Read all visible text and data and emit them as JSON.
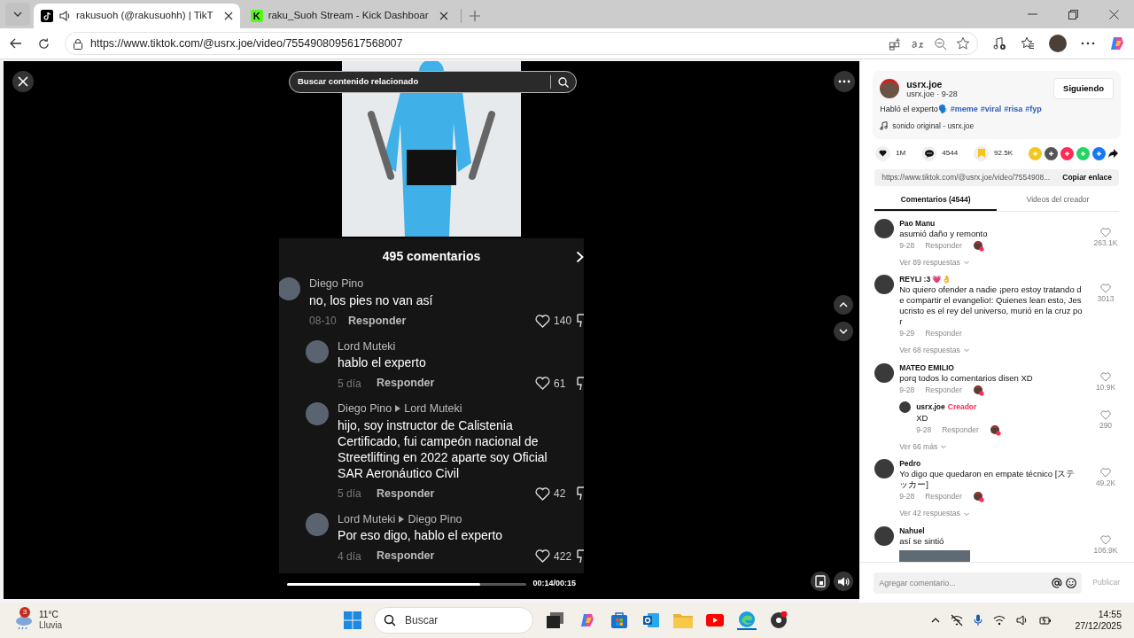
{
  "browser": {
    "tabs": [
      {
        "kind": "music-note",
        "title": "rakusuoh (@rakusuohh) | TikT",
        "playing": true,
        "selected": true
      },
      {
        "kind": "letter",
        "letter": "K",
        "title": "raku_Suoh Stream - Kick Dashboar",
        "playing": false,
        "selected": false
      }
    ],
    "url": "https://www.tiktok.com/@usrx.joe/video/7554908095617568007"
  },
  "video": {
    "search_placeholder": "Buscar contenido relacionado",
    "comments_title": "495 comentarios",
    "comments": [
      {
        "name": "Diego Pino",
        "text": "no, los pies no van así",
        "date": "08-10",
        "reply": "Responder",
        "likes": "140",
        "children": [
          {
            "name": "Lord Muteki",
            "text": "hablo el experto",
            "date": "5 día",
            "reply": "Responder",
            "likes": "61"
          },
          {
            "name": "Diego Pino",
            "reply_to": "Lord Muteki",
            "text": "hijo, soy instructor de Calistenia Certificado, fui campeón nacional de Streetlifting en 2022 aparte soy Oficial SAR Aeronáutico Civil",
            "date": "5 día",
            "reply": "Responder",
            "likes": "42"
          },
          {
            "name": "Lord Muteki",
            "reply_to": "Diego Pino",
            "text": "Por eso digo, hablo el experto",
            "date": "4 día",
            "reply": "Responder",
            "likes": "422"
          }
        ]
      }
    ],
    "progress": {
      "level": 0.81
    },
    "time": "00:14/00:15"
  },
  "panel": {
    "author": "usrx.joe",
    "meta": "usrx.joe · 9-28",
    "follow": "Siguiendo",
    "caption": "Habló el experto🗣️",
    "hashtags": [
      "#meme",
      "#viral",
      "#risa",
      "#fyp"
    ],
    "sound": "sonido original - usrx.joe",
    "stats": {
      "likes": "1M",
      "comments": "4544",
      "saves": "92.5K"
    },
    "link": "https://www.tiktok.com/@usrx.joe/video/7554908...",
    "copy": "Copiar enlace",
    "tabs": [
      {
        "label": "Comentarios (4544)",
        "selected": true
      },
      {
        "label": "Videos del creador",
        "selected": false
      }
    ],
    "comments": [
      {
        "name": "Pao Manu",
        "text": "asumió daño y remonto",
        "date": "9-28",
        "reply": "Responder",
        "liked_by_creator": true,
        "likes": "263.1K",
        "more": "Ver 89 respuestas"
      },
      {
        "name": "REYLI :3 💗👌",
        "text": "No quiero ofender a nadie ¡pero estoy tratando de compartir el evangelio!: Quienes lean esto, Jesucristo es el rey del universo, murió en la cruz por",
        "date": "9-29",
        "reply": "Responder",
        "liked_by_creator": false,
        "likes": "3013",
        "more": "Ver 68 respuestas"
      },
      {
        "name": "MATEO EMILIO",
        "text": "porq todos lo comentarios disen XD",
        "date": "9-28",
        "reply": "Responder",
        "liked_by_creator": true,
        "likes": "10.9K",
        "children": [
          {
            "name": "usrx.joe",
            "badge": "Creador",
            "text": "XD",
            "date": "9-28",
            "reply": "Responder",
            "liked_by_creator": true,
            "likes": "290"
          }
        ],
        "more": "Ver 66 más"
      },
      {
        "name": "Pedro",
        "text": "Yo digo que quedaron en empate técnico [ステッカー]",
        "date": "9-28",
        "reply": "Responder",
        "liked_by_creator": true,
        "likes": "49.2K",
        "more": "Ver 42 respuestas"
      },
      {
        "name": "Nahuel",
        "text": "así se sintió",
        "has_image": true,
        "likes": "106.9K"
      }
    ],
    "input_placeholder": "Agregar comentario...",
    "publish": "Publicar"
  },
  "taskbar": {
    "weather_badge": "3",
    "temperature": "11°C",
    "condition": "Lluvia",
    "search": "Buscar",
    "time": "14:55",
    "date": "27/12/2025"
  }
}
